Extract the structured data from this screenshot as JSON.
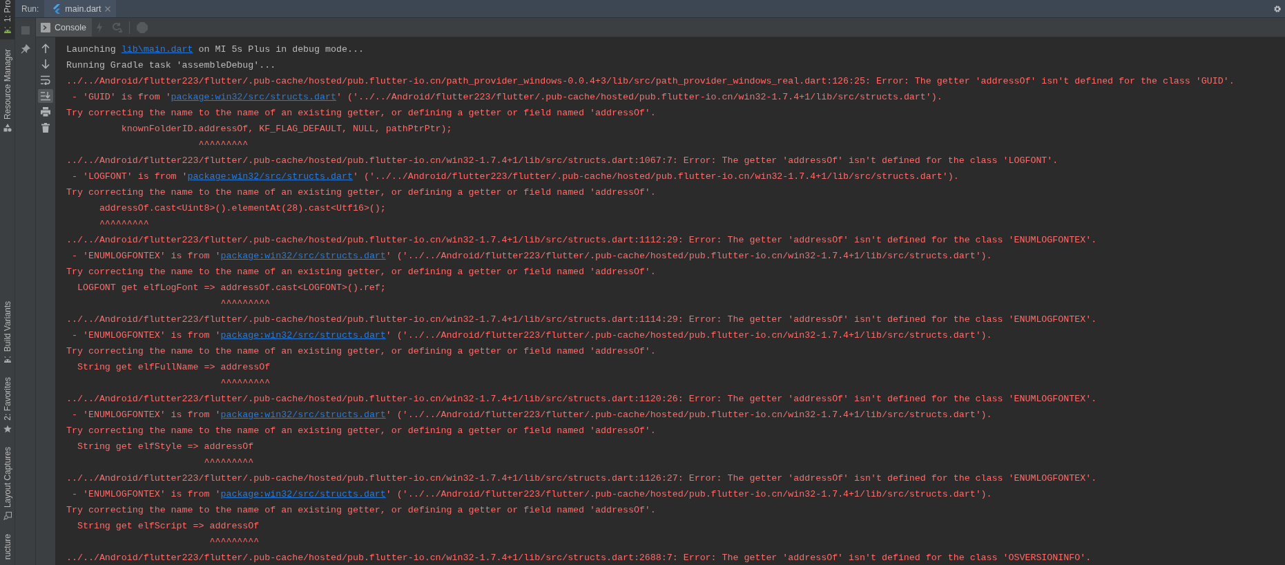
{
  "sidebar": {
    "top": [
      {
        "label": "1: Pro",
        "kind": "android",
        "selected": true
      },
      {
        "label": "Resource Manager",
        "kind": "shapes",
        "selected": false
      }
    ],
    "bottom": [
      {
        "label": "Build Variants",
        "kind": "android",
        "selected": false
      },
      {
        "label": "2: Favorites",
        "kind": "star",
        "selected": false
      },
      {
        "label": "Layout Captures",
        "kind": "capture",
        "selected": false
      },
      {
        "label": "ructure",
        "kind": "plain",
        "selected": false
      }
    ]
  },
  "run_panel": {
    "label": "Run:",
    "tabs": [
      {
        "label": "main.dart",
        "selected": true
      }
    ],
    "side_actions": [
      {
        "kind": "stop",
        "disabled": true
      },
      {
        "kind": "pin",
        "disabled": false
      }
    ],
    "console_tab": {
      "label": "Console",
      "selected": true
    },
    "console_actions": [
      {
        "kind": "lightning",
        "disabled": true
      },
      {
        "kind": "rerun",
        "disabled": true
      },
      {
        "kind": "halt",
        "disabled": true
      }
    ],
    "console_toolbar": [
      {
        "kind": "up",
        "on": false
      },
      {
        "kind": "down",
        "on": false
      },
      {
        "kind": "wrap",
        "on": false
      },
      {
        "kind": "scroll-end",
        "on": true
      },
      {
        "kind": "print",
        "on": false
      },
      {
        "kind": "trash",
        "on": false
      }
    ]
  },
  "console": {
    "lines": [
      {
        "kind": "info",
        "before": "Launching ",
        "link": "lib\\main.dart",
        "after": " on MI 5s Plus in debug mode..."
      },
      {
        "kind": "info",
        "text": "Running Gradle task 'assembleDebug'..."
      },
      {
        "kind": "error",
        "text": "../../Android/flutter223/flutter/.pub-cache/hosted/pub.flutter-io.cn/path_provider_windows-0.0.4+3/lib/src/path_provider_windows_real.dart:126:25: Error: The getter 'addressOf' isn't defined for the class 'GUID'."
      },
      {
        "kind": "error",
        "before": " - 'GUID' is from '",
        "link": "package:win32/src/structs.dart",
        "after": "' ('../../Android/flutter223/flutter/.pub-cache/hosted/pub.flutter-io.cn/win32-1.7.4+1/lib/src/structs.dart')."
      },
      {
        "kind": "error",
        "text": "Try correcting the name to the name of an existing getter, or defining a getter or field named 'addressOf'."
      },
      {
        "kind": "error",
        "text": "          knownFolderID.addressOf, KF_FLAG_DEFAULT, NULL, pathPtrPtr);"
      },
      {
        "kind": "error",
        "text": "                        ^^^^^^^^^"
      },
      {
        "kind": "error",
        "text": "../../Android/flutter223/flutter/.pub-cache/hosted/pub.flutter-io.cn/win32-1.7.4+1/lib/src/structs.dart:1067:7: Error: The getter 'addressOf' isn't defined for the class 'LOGFONT'."
      },
      {
        "kind": "error",
        "before": " - 'LOGFONT' is from '",
        "link": "package:win32/src/structs.dart",
        "after": "' ('../../Android/flutter223/flutter/.pub-cache/hosted/pub.flutter-io.cn/win32-1.7.4+1/lib/src/structs.dart')."
      },
      {
        "kind": "error",
        "text": "Try correcting the name to the name of an existing getter, or defining a getter or field named 'addressOf'."
      },
      {
        "kind": "error",
        "text": "      addressOf.cast<Uint8>().elementAt(28).cast<Utf16>();"
      },
      {
        "kind": "error",
        "text": "      ^^^^^^^^^"
      },
      {
        "kind": "error",
        "text": "../../Android/flutter223/flutter/.pub-cache/hosted/pub.flutter-io.cn/win32-1.7.4+1/lib/src/structs.dart:1112:29: Error: The getter 'addressOf' isn't defined for the class 'ENUMLOGFONTEX'."
      },
      {
        "kind": "error",
        "before": " - 'ENUMLOGFONTEX' is from '",
        "link": "package:win32/src/structs.dart",
        "after": "' ('../../Android/flutter223/flutter/.pub-cache/hosted/pub.flutter-io.cn/win32-1.7.4+1/lib/src/structs.dart')."
      },
      {
        "kind": "error",
        "text": "Try correcting the name to the name of an existing getter, or defining a getter or field named 'addressOf'."
      },
      {
        "kind": "error",
        "text": "  LOGFONT get elfLogFont => addressOf.cast<LOGFONT>().ref;"
      },
      {
        "kind": "error",
        "text": "                            ^^^^^^^^^"
      },
      {
        "kind": "error",
        "text": "../../Android/flutter223/flutter/.pub-cache/hosted/pub.flutter-io.cn/win32-1.7.4+1/lib/src/structs.dart:1114:29: Error: The getter 'addressOf' isn't defined for the class 'ENUMLOGFONTEX'."
      },
      {
        "kind": "error",
        "before": " - 'ENUMLOGFONTEX' is from '",
        "link": "package:win32/src/structs.dart",
        "after": "' ('../../Android/flutter223/flutter/.pub-cache/hosted/pub.flutter-io.cn/win32-1.7.4+1/lib/src/structs.dart')."
      },
      {
        "kind": "error",
        "text": "Try correcting the name to the name of an existing getter, or defining a getter or field named 'addressOf'."
      },
      {
        "kind": "error",
        "text": "  String get elfFullName => addressOf"
      },
      {
        "kind": "error",
        "text": "                            ^^^^^^^^^"
      },
      {
        "kind": "error",
        "text": "../../Android/flutter223/flutter/.pub-cache/hosted/pub.flutter-io.cn/win32-1.7.4+1/lib/src/structs.dart:1120:26: Error: The getter 'addressOf' isn't defined for the class 'ENUMLOGFONTEX'."
      },
      {
        "kind": "error",
        "before": " - 'ENUMLOGFONTEX' is from '",
        "link": "package:win32/src/structs.dart",
        "after": "' ('../../Android/flutter223/flutter/.pub-cache/hosted/pub.flutter-io.cn/win32-1.7.4+1/lib/src/structs.dart')."
      },
      {
        "kind": "error",
        "text": "Try correcting the name to the name of an existing getter, or defining a getter or field named 'addressOf'."
      },
      {
        "kind": "error",
        "text": "  String get elfStyle => addressOf"
      },
      {
        "kind": "error",
        "text": "                         ^^^^^^^^^"
      },
      {
        "kind": "error",
        "text": "../../Android/flutter223/flutter/.pub-cache/hosted/pub.flutter-io.cn/win32-1.7.4+1/lib/src/structs.dart:1126:27: Error: The getter 'addressOf' isn't defined for the class 'ENUMLOGFONTEX'."
      },
      {
        "kind": "error",
        "before": " - 'ENUMLOGFONTEX' is from '",
        "link": "package:win32/src/structs.dart",
        "after": "' ('../../Android/flutter223/flutter/.pub-cache/hosted/pub.flutter-io.cn/win32-1.7.4+1/lib/src/structs.dart')."
      },
      {
        "kind": "error",
        "text": "Try correcting the name to the name of an existing getter, or defining a getter or field named 'addressOf'."
      },
      {
        "kind": "error",
        "text": "  String get elfScript => addressOf"
      },
      {
        "kind": "error",
        "text": "                          ^^^^^^^^^"
      },
      {
        "kind": "error",
        "text": "../../Android/flutter223/flutter/.pub-cache/hosted/pub.flutter-io.cn/win32-1.7.4+1/lib/src/structs.dart:2688:7: Error: The getter 'addressOf' isn't defined for the class 'OSVERSIONINFO'."
      }
    ]
  }
}
